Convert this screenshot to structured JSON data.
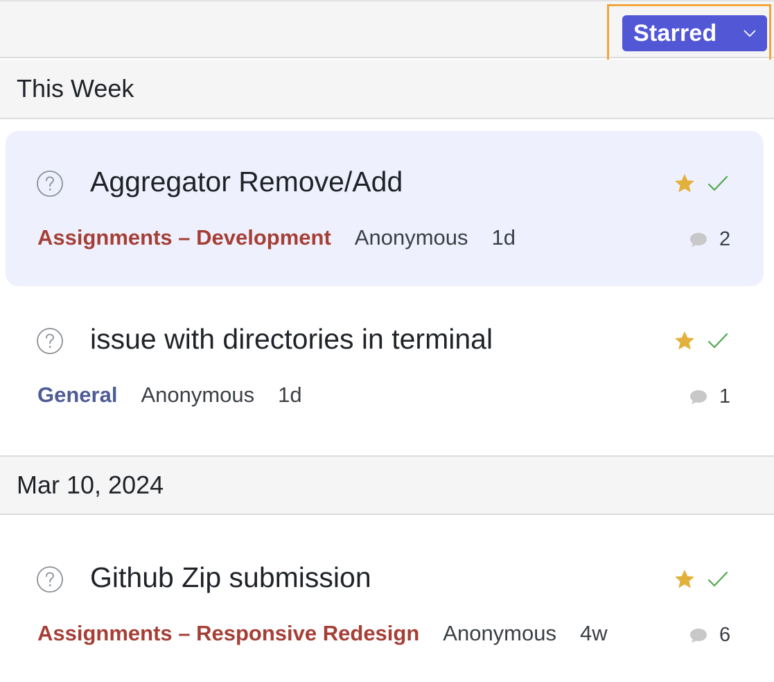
{
  "toolbar": {
    "filter_label": "Starred",
    "filter_color": "#5257d6",
    "highlight_color": "#f0a63c"
  },
  "sections": [
    {
      "header": "This Week",
      "posts": [
        {
          "title": "Aggregator Remove/Add",
          "category": "Assignments – Development",
          "category_color": "#a53f36",
          "author": "Anonymous",
          "age": "1d",
          "comments": "2",
          "starred": true,
          "resolved": true,
          "selected": true,
          "icon": "question-circle-icon"
        },
        {
          "title": "issue with directories in terminal",
          "category": "General",
          "category_color": "#4e5c96",
          "author": "Anonymous",
          "age": "1d",
          "comments": "1",
          "starred": true,
          "resolved": true,
          "selected": false,
          "icon": "question-circle-icon"
        }
      ]
    },
    {
      "header": "Mar 10, 2024",
      "posts": [
        {
          "title": "Github Zip submission",
          "category": "Assignments – Responsive Redesign",
          "category_color": "#a53f36",
          "author": "Anonymous",
          "age": "4w",
          "comments": "6",
          "starred": true,
          "resolved": true,
          "selected": false,
          "icon": "question-circle-icon"
        }
      ]
    }
  ],
  "colors": {
    "star": "#e2b13c",
    "check": "#4fa84b",
    "comment_icon": "#c8c8c8",
    "selected_bg": "#eef1fd"
  }
}
